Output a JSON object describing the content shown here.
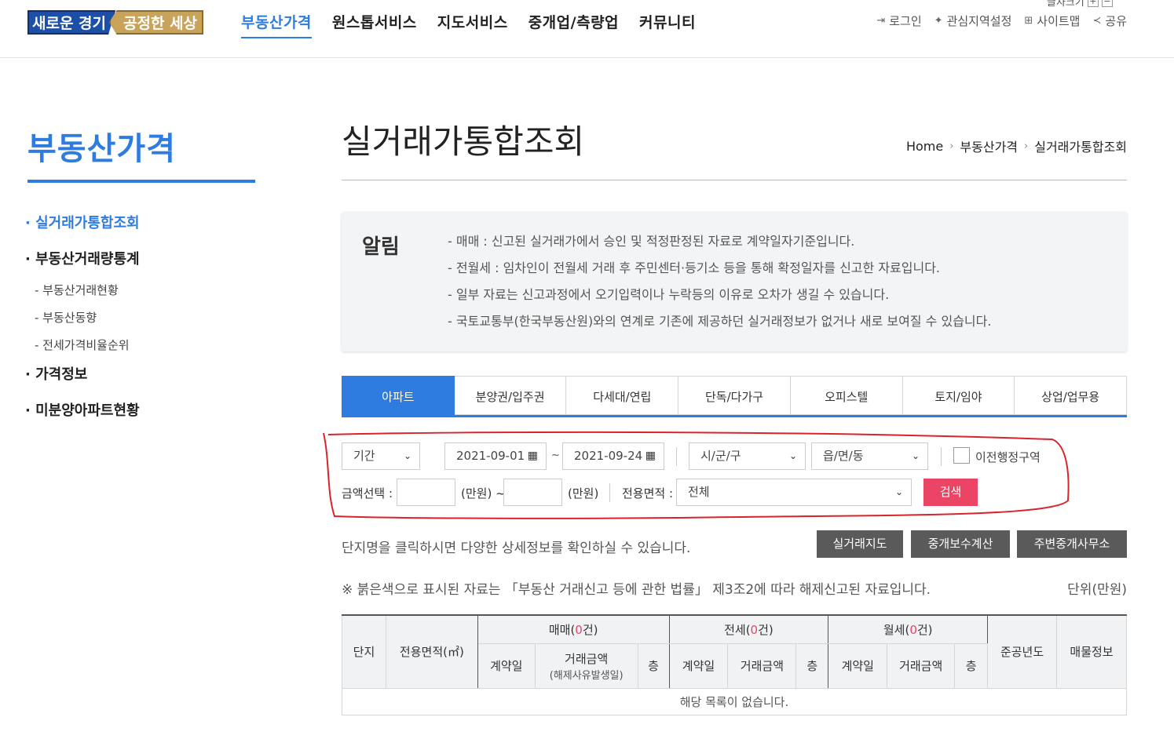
{
  "header": {
    "logo_part1": "새로운 경기",
    "logo_part2": "공정한 세상",
    "font_size_label": "글자크기",
    "nav": [
      "부동산가격",
      "원스톱서비스",
      "지도서비스",
      "중개업/측량업",
      "커뮤니티"
    ],
    "util": [
      {
        "icon": "login-icon",
        "label": "로그인"
      },
      {
        "icon": "pin-icon",
        "label": "관심지역설정"
      },
      {
        "icon": "sitemap-icon",
        "label": "사이트맵"
      },
      {
        "icon": "share-icon",
        "label": "공유"
      }
    ]
  },
  "sidebar": {
    "title": "부동산가격",
    "items": [
      {
        "label": "· 실거래가통합조회",
        "level": 1,
        "active": true
      },
      {
        "label": "· 부동산거래량통계",
        "level": 1
      },
      {
        "label": "- 부동산거래현황",
        "level": 2
      },
      {
        "label": "- 부동산동향",
        "level": 2
      },
      {
        "label": "- 전세가격비율순위",
        "level": 2
      },
      {
        "label": "· 가격정보",
        "level": 1
      },
      {
        "label": "· 미분양아파트현황",
        "level": 1
      }
    ]
  },
  "main": {
    "title": "실거래가통합조회",
    "breadcrumb": [
      "Home",
      "부동산가격",
      "실거래가통합조회"
    ],
    "notice": {
      "title": "알림",
      "lines": [
        "- 매매 : 신고된 실거래가에서 승인 및 적정판정된 자료로 계약일자기준입니다.",
        "- 전월세 : 임차인이 전월세 거래 후 주민센터·등기소 등을 통해 확정일자를 신고한 자료입니다.",
        "- 일부 자료는 신고과정에서 오기입력이나 누락등의 이유로 오차가 생길 수 있습니다.",
        "- 국토교통부(한국부동산원)와의 연계로 기존에 제공하던 실거래정보가 없거나 새로 보여질 수 있습니다."
      ]
    },
    "tabs": [
      "아파트",
      "분양권/입주권",
      "다세대/연립",
      "단독/다가구",
      "오피스텔",
      "토지/임야",
      "상업/업무용"
    ],
    "search": {
      "period": "기간",
      "date_from": "2021-09-01",
      "date_to": "2021-09-24",
      "tilde": "~",
      "sigungu": "시/군/구",
      "dong": "읍/면/동",
      "old_district": "이전행정구역",
      "amount_label": "금액선택 :",
      "unit_from": "(만원) ~",
      "unit_to": "(만원)",
      "area_label": "전용면적 :",
      "area_value": "전체",
      "search_button": "검색"
    },
    "desc": "단지명을 클릭하시면 다양한 상세정보를 확인하실 수 있습니다.",
    "buttons": [
      "실거래지도",
      "중개보수계산",
      "주변중개사무소"
    ],
    "note": "※ 붉은색으로 표시된 자료는 「부동산 거래신고 등에 관한 법률」 제3조2에 따라 해제신고된 자료입니다.",
    "unit": "단위(만원)",
    "table": {
      "col_danji": "단지",
      "col_area": "전용면적(㎡)",
      "group_sale": "매매(",
      "group_jeonse": "전세(",
      "group_wolse": "월세(",
      "count": "0",
      "count_suffix": "건)",
      "col_contract": "계약일",
      "col_price": "거래금액",
      "col_price_sub": "(해제사유발생일)",
      "col_floor": "층",
      "col_built": "준공년도",
      "col_listing": "매물정보",
      "empty": "해당 목록이 없습니다."
    }
  }
}
